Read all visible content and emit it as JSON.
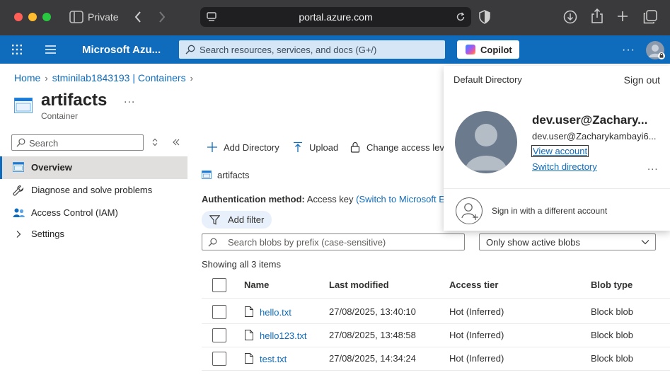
{
  "browser": {
    "private_label": "Private",
    "url": "portal.azure.com"
  },
  "topbar": {
    "title": "Microsoft Azu...",
    "search_placeholder": "Search resources, services, and docs (G+/)",
    "copilot_label": "Copilot"
  },
  "breadcrumb": {
    "items": [
      "Home",
      "stminilab1843193 | Containers"
    ]
  },
  "resource": {
    "title": "artifacts",
    "subtitle": "Container",
    "more": "..."
  },
  "sidebar": {
    "search_placeholder": "Search",
    "items": [
      {
        "label": "Overview",
        "icon": "container-icon",
        "active": true
      },
      {
        "label": "Diagnose and solve problems",
        "icon": "wrench-icon"
      },
      {
        "label": "Access Control (IAM)",
        "icon": "people-icon"
      },
      {
        "label": "Settings",
        "icon": "chevron-right-icon"
      }
    ]
  },
  "toolbar": {
    "add_directory": "Add Directory",
    "upload": "Upload",
    "change_access": "Change access leve"
  },
  "main": {
    "path": "artifacts",
    "auth_label": "Authentication method:",
    "auth_value": "Access key",
    "auth_switch": "(Switch to Microsoft En",
    "add_filter": "Add filter",
    "blob_search_placeholder": "Search blobs by prefix (case-sensitive)",
    "blob_filter": "Only show active blobs",
    "count": "Showing all 3 items"
  },
  "table": {
    "headers": {
      "name": "Name",
      "modified": "Last modified",
      "tier": "Access tier",
      "type": "Blob type"
    },
    "rows": [
      {
        "name": "hello.txt",
        "modified": "27/08/2025, 13:40:10",
        "tier": "Hot (Inferred)",
        "type": "Block blob"
      },
      {
        "name": "hello123.txt",
        "modified": "27/08/2025, 13:48:58",
        "tier": "Hot (Inferred)",
        "type": "Block blob"
      },
      {
        "name": "test.txt",
        "modified": "27/08/2025, 14:34:24",
        "tier": "Hot (Inferred)",
        "type": "Block blob"
      }
    ]
  },
  "account": {
    "directory": "Default Directory",
    "sign_out": "Sign out",
    "name": "dev.user@Zachary...",
    "email": "dev.user@Zacharykambayi6...",
    "view_account": "View account",
    "switch_directory": "Switch directory",
    "more": "...",
    "other_account": "Sign in with a different account"
  },
  "colors": {
    "accent": "#0f6cbd",
    "topbar": "#0f6cbd",
    "safari": "#3a3a3c"
  }
}
